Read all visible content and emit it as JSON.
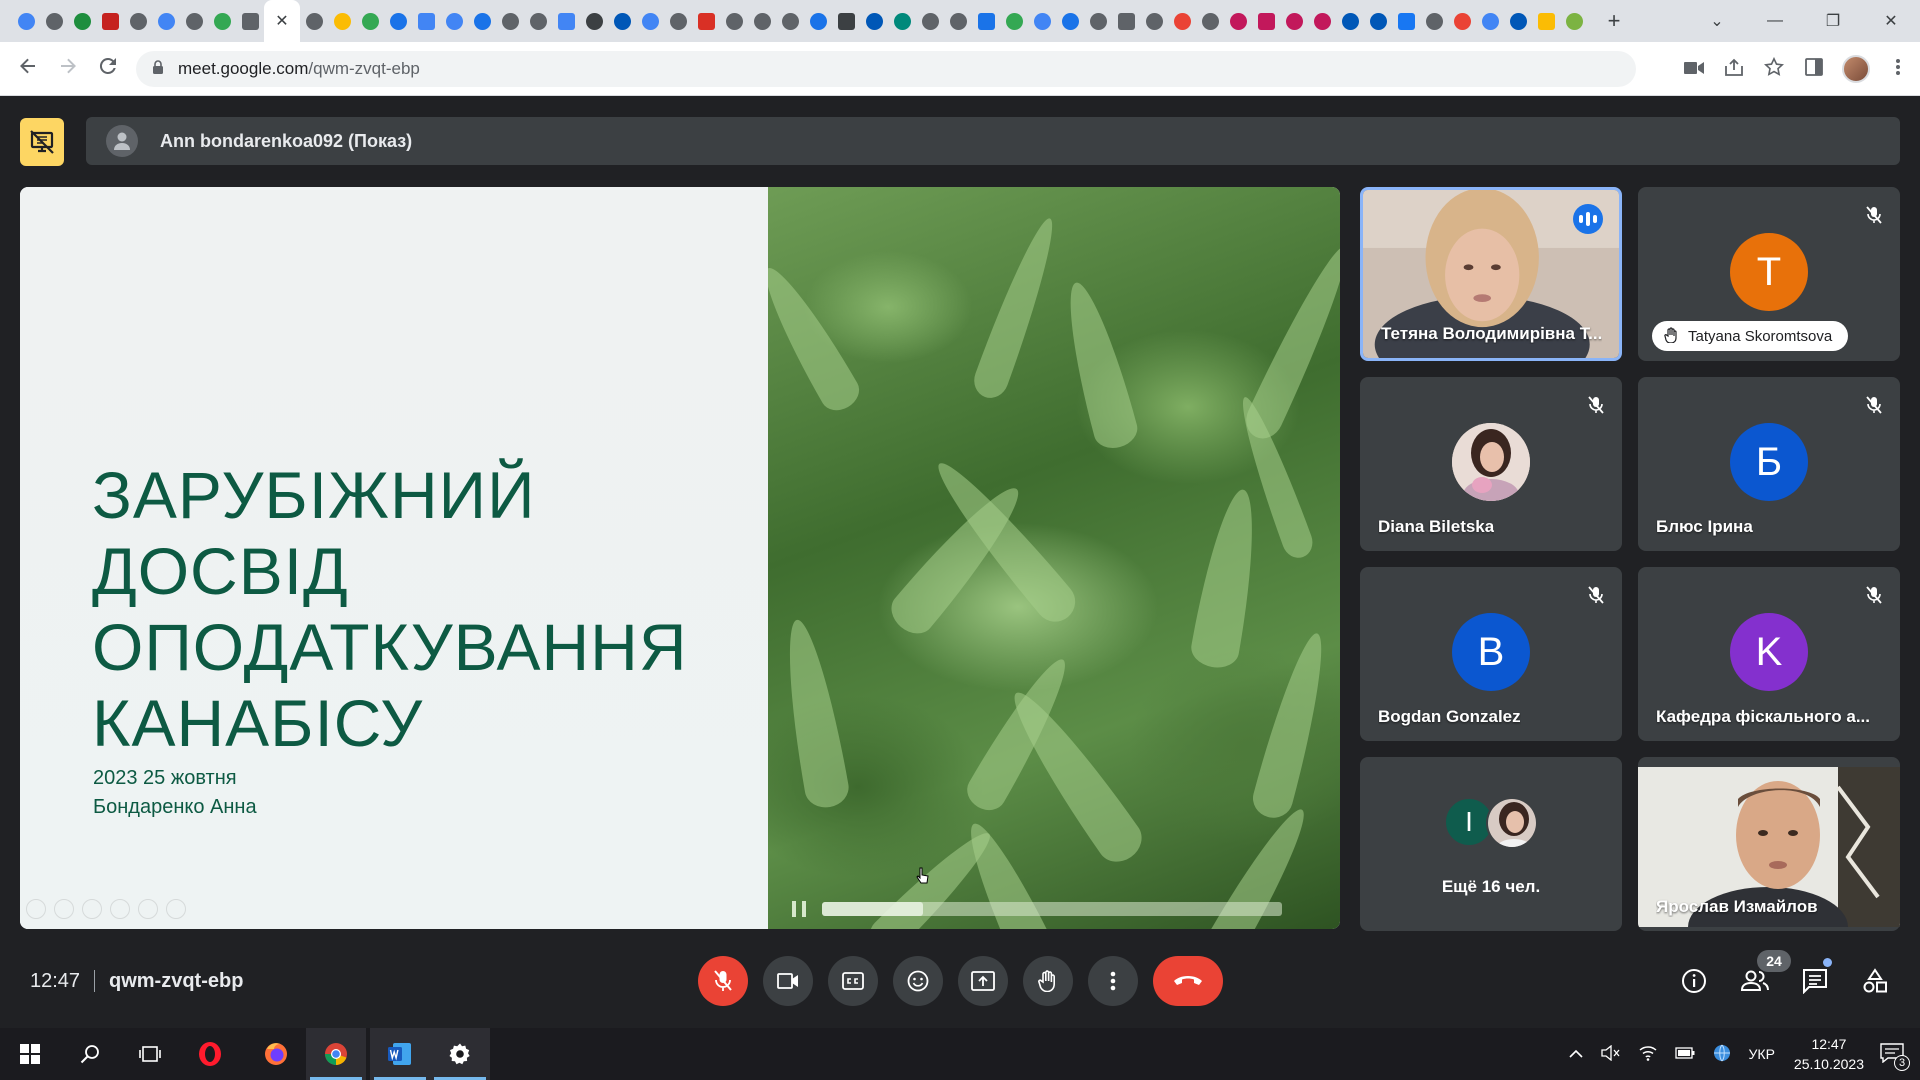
{
  "browser": {
    "url_host": "meet.google.com",
    "url_path": "/qwm-zvqt-ebp",
    "favicons": [
      "#4285f4",
      "#5f6368",
      "#1e8e3e",
      "#c5221f",
      "#5f6368",
      "#4285f4",
      "#5f6368",
      "#34a853",
      "#5f6368",
      "#5f6368",
      "#fbbc04",
      "#34a853",
      "#1a73e8",
      "#4285f4",
      "#4285f4",
      "#1a73e8",
      "#5f6368",
      "#5f6368",
      "#4285f4",
      "#3c4043",
      "#0057b7",
      "#4285f4",
      "#5f6368",
      "#d93025",
      "#5f6368",
      "#5f6368",
      "#5f6368",
      "#1a73e8",
      "#3c4043",
      "#0057b7",
      "#00897b",
      "#5f6368",
      "#5f6368",
      "#1a73e8",
      "#34a853",
      "#4285f4",
      "#1a73e8",
      "#5f6368",
      "#5f6368",
      "#5f6368",
      "#ea4335",
      "#5f6368",
      "#c2185b",
      "#c2185b",
      "#c2185b",
      "#c2185b",
      "#0057b7",
      "#0057b7",
      "#1877f2",
      "#5f6368",
      "#ea4335",
      "#4285f4",
      "#0057b7",
      "#fbbc04",
      "#7cb342"
    ],
    "new_tab_label": "+",
    "close_tab_label": "✕",
    "window_controls": [
      "⌄",
      "—",
      "❐",
      "✕"
    ]
  },
  "meet": {
    "presenter_label": "Ann bondarenkoa092 (Показ)",
    "clock": "12:47",
    "meeting_code": "qwm-zvqt-ebp",
    "participants_count": "24"
  },
  "slide": {
    "title_lines": [
      "ЗАРУБІЖНИЙ",
      "ДОСВІД",
      "ОПОДАТКУВАННЯ",
      "КАНАБІСУ"
    ],
    "meta_lines": [
      "2023 25 жовтня",
      "Бондаренко Анна"
    ],
    "video_progress": 0.22
  },
  "participants": [
    {
      "name": "Тетяна Володимирівна Т...",
      "type": "video",
      "speaking": true,
      "muted": false
    },
    {
      "name": "Tatyana Skoromtsova",
      "type": "avatar",
      "initial": "T",
      "color": "#e8710a",
      "hand_raised": true,
      "muted": true
    },
    {
      "name": "Diana Biletska",
      "type": "photo",
      "muted": true
    },
    {
      "name": "Блюс Ірина",
      "type": "avatar",
      "initial": "Б",
      "color": "#0b57d0",
      "muted": true
    },
    {
      "name": "Bogdan Gonzalez",
      "type": "avatar",
      "initial": "B",
      "color": "#0b57d0",
      "muted": true
    },
    {
      "name": "Кафедра фіскального а...",
      "type": "avatar",
      "initial": "K",
      "color": "#8430ce",
      "muted": true
    },
    {
      "name": "Ещё 16 чел.",
      "type": "group",
      "initial": "I",
      "color": "#0f5c4d"
    },
    {
      "name": "Ярослав Измайлов",
      "type": "video",
      "muted": true
    }
  ],
  "controls": {
    "center": [
      "mic-off",
      "camera",
      "captions",
      "emoji",
      "present",
      "raise-hand",
      "more",
      "leave-call"
    ],
    "right": [
      "info",
      "people",
      "chat",
      "activities"
    ]
  },
  "taskbar": {
    "lang": "УКР",
    "time": "12:47",
    "date": "25.10.2023",
    "notifications": "3"
  }
}
